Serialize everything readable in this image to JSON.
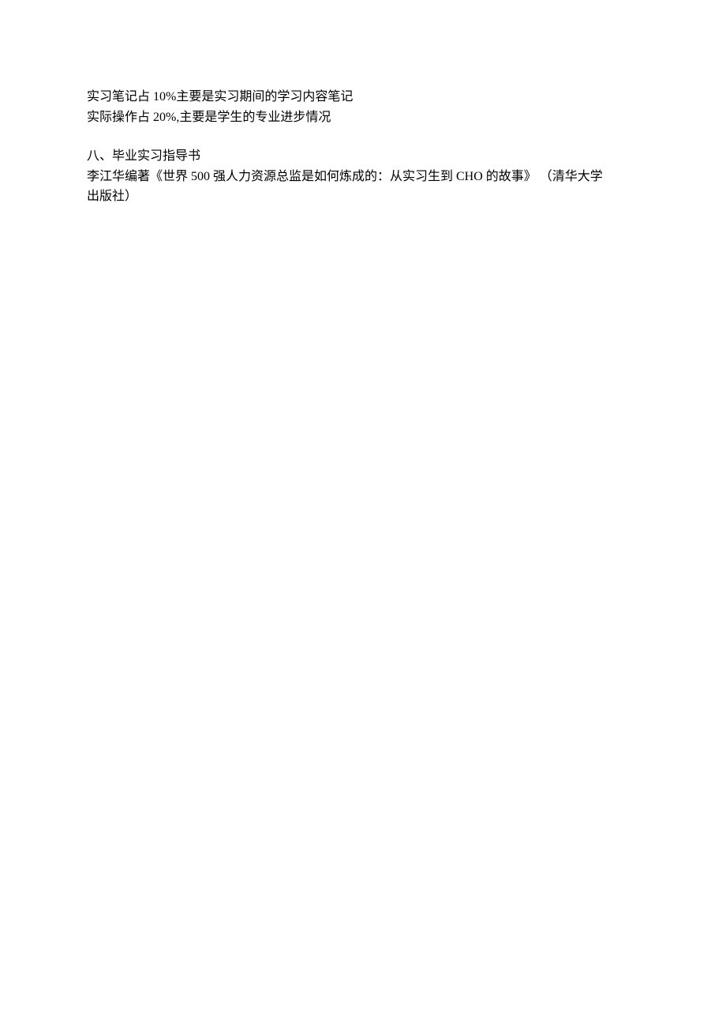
{
  "content": {
    "line1": "实习笔记占 10%主要是实习期间的学习内容笔记",
    "line2": "实际操作占 20%,主要是学生的专业进步情况",
    "heading": "八、毕业实习指导书",
    "reference_line1": "李江华编著《世界 500 强人力资源总监是如何炼成的：从实习生到 CHO 的故事》 （清华大学",
    "reference_line2": "出版社）"
  }
}
